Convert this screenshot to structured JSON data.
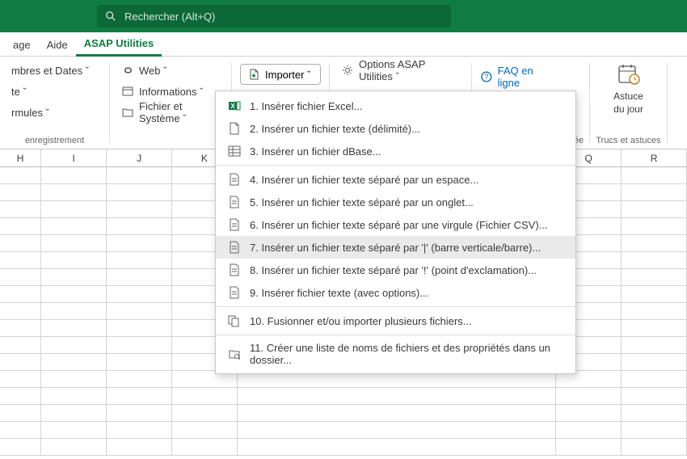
{
  "search": {
    "placeholder": "Rechercher (Alt+Q)"
  },
  "tabs": {
    "t0": "age",
    "t1": "Aide",
    "t2": "ASAP Utilities"
  },
  "ribbon": {
    "nbdates": "mbres et Dates ˇ",
    "te": "te ˇ",
    "rmules": "rmules ˇ",
    "enreg": "enregistrement",
    "web": "Web ˇ",
    "informations": "Informations ˇ",
    "fichier": "Fichier et Système ˇ",
    "importer": "Importer ˇ",
    "options": "Options ASAP Utilities ˇ",
    "faq": "FAQ en ligne",
    "astuce1": "Astuce",
    "astuce2": "du jour",
    "tips": "Trucs et astuces",
    "ree": "rée"
  },
  "cols": [
    "H",
    "I",
    "J",
    "K",
    "",
    "Q",
    "R"
  ],
  "dropdown": {
    "i1": "1. Insérer fichier Excel...",
    "i2": "2. Insérer un fichier texte (délimité)...",
    "i3": "3. Insérer un fichier dBase...",
    "i4": "4. Insérer un fichier texte séparé par un espace...",
    "i5": "5. Insérer un fichier texte séparé par un onglet...",
    "i6": "6. Insérer un fichier texte séparé par une virgule (Fichier CSV)...",
    "i7": "7. Insérer un fichier texte séparé par '|' (barre verticale/barre)...",
    "i8": "8. Insérer un fichier texte séparé par '!' (point d'exclamation)...",
    "i9": "9. Insérer fichier texte (avec options)...",
    "i10": "10. Fusionner et/ou importer plusieurs fichiers...",
    "i11": "11. Créer une liste de noms de fichiers et des propriétés dans un dossier..."
  }
}
